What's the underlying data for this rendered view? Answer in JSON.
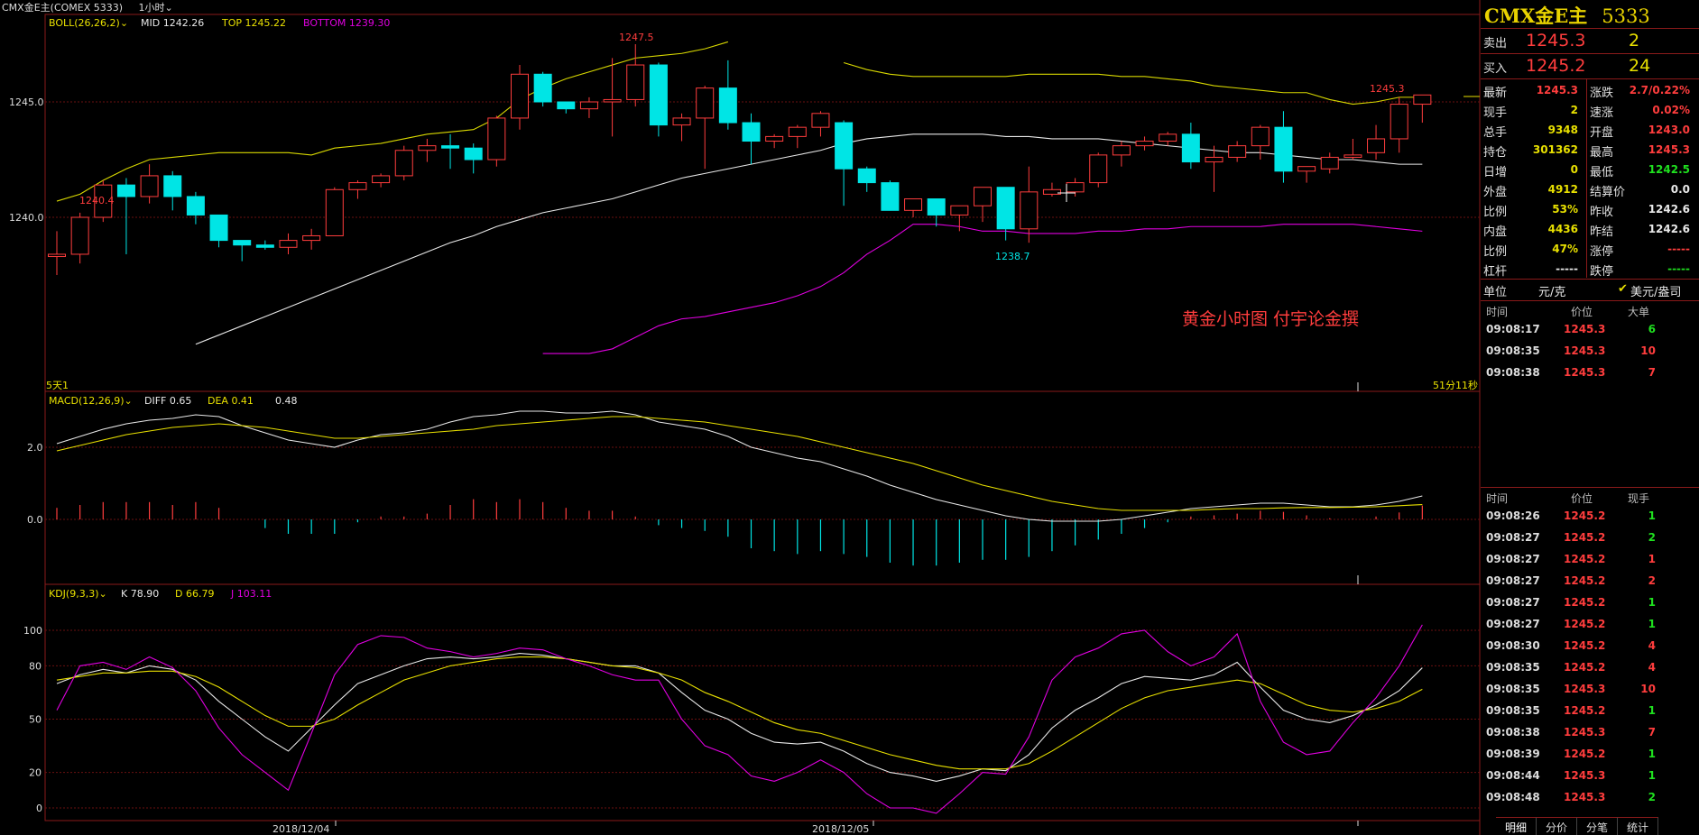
{
  "header": {
    "title": "CMX金E主(COMEX 5333)",
    "period": "1小时"
  },
  "indicators": {
    "boll": {
      "name": "BOLL(26,26,2)",
      "mid": "MID 1242.26",
      "top": "TOP 1245.22",
      "bottom": "BOTTOM 1239.30"
    },
    "macd": {
      "name": "MACD(12,26,9)",
      "diff": "DIFF 0.65",
      "dea": "DEA 0.41",
      "macd": "0.48"
    },
    "kdj": {
      "name": "KDJ(9,3,3)",
      "k": "K 78.90",
      "d": "D 66.79",
      "j": "J 103.11"
    }
  },
  "main_axis": {
    "labels": [
      "1245.0",
      "1240.0"
    ]
  },
  "macd_axis": {
    "labels": [
      "2.0",
      "0.0"
    ]
  },
  "kdj_axis": {
    "labels": [
      "100",
      "80",
      "50",
      "20",
      "0"
    ]
  },
  "x_axis": {
    "labels": [
      "2018/12/04",
      "2018/12/05"
    ]
  },
  "annotations": {
    "high": "1247.5",
    "left_high": "1240.4",
    "low": "1238.7",
    "last_high": "1245.3",
    "watermark": "黄金小时图  付宇论金撰",
    "left_tag": "5天1",
    "right_tag": "51分11秒"
  },
  "colors": {
    "up": "#ff3d3d",
    "down": "#00e5e5",
    "mid": "#e8e8e8",
    "upper": "#d8d800",
    "lower": "#e000e0",
    "grid": "#6a1010"
  },
  "chart_data": {
    "type": "candlestick",
    "candles": [
      [
        1238.3,
        1238.4,
        1237.5,
        1239.4
      ],
      [
        1238.4,
        1240.0,
        1238.0,
        1240.2
      ],
      [
        1240.0,
        1241.4,
        1239.8,
        1241.6
      ],
      [
        1241.4,
        1240.9,
        1238.4,
        1241.7
      ],
      [
        1240.9,
        1241.8,
        1240.6,
        1242.3
      ],
      [
        1241.8,
        1240.9,
        1240.3,
        1242.0
      ],
      [
        1240.9,
        1240.1,
        1239.7,
        1241.1
      ],
      [
        1240.1,
        1239.0,
        1238.7,
        1240.1
      ],
      [
        1239.0,
        1238.8,
        1238.1,
        1239.0
      ],
      [
        1238.8,
        1238.7,
        1238.6,
        1239.0
      ],
      [
        1238.7,
        1239.0,
        1238.4,
        1239.3
      ],
      [
        1239.0,
        1239.2,
        1238.6,
        1239.5
      ],
      [
        1239.2,
        1241.2,
        1239.2,
        1241.3
      ],
      [
        1241.2,
        1241.5,
        1240.8,
        1241.6
      ],
      [
        1241.5,
        1241.8,
        1241.3,
        1241.9
      ],
      [
        1241.8,
        1242.9,
        1241.6,
        1243.1
      ],
      [
        1242.9,
        1243.1,
        1242.4,
        1243.4
      ],
      [
        1243.1,
        1243.0,
        1242.1,
        1243.6
      ],
      [
        1243.0,
        1242.5,
        1241.9,
        1243.2
      ],
      [
        1242.5,
        1244.3,
        1242.2,
        1244.4
      ],
      [
        1244.3,
        1246.2,
        1243.8,
        1246.6
      ],
      [
        1246.2,
        1245.0,
        1244.8,
        1246.3
      ],
      [
        1245.0,
        1244.7,
        1244.5,
        1245.0
      ],
      [
        1244.7,
        1245.0,
        1244.3,
        1245.2
      ],
      [
        1245.0,
        1245.1,
        1243.5,
        1246.9
      ],
      [
        1245.1,
        1246.6,
        1244.8,
        1247.5
      ],
      [
        1246.6,
        1244.0,
        1243.5,
        1246.7
      ],
      [
        1244.0,
        1244.3,
        1243.3,
        1244.5
      ],
      [
        1244.3,
        1245.6,
        1242.1,
        1245.7
      ],
      [
        1245.6,
        1244.1,
        1243.8,
        1246.8
      ],
      [
        1244.1,
        1243.3,
        1242.3,
        1244.5
      ],
      [
        1243.3,
        1243.5,
        1243.0,
        1243.6
      ],
      [
        1243.5,
        1243.9,
        1243.0,
        1244.0
      ],
      [
        1243.9,
        1244.5,
        1243.5,
        1244.6
      ],
      [
        1244.1,
        1242.1,
        1240.5,
        1244.2
      ],
      [
        1242.1,
        1241.5,
        1241.1,
        1242.2
      ],
      [
        1241.5,
        1240.3,
        1240.3,
        1241.6
      ],
      [
        1240.3,
        1240.8,
        1240.0,
        1240.8
      ],
      [
        1240.8,
        1240.1,
        1239.6,
        1240.8
      ],
      [
        1240.1,
        1240.5,
        1239.4,
        1240.5
      ],
      [
        1240.5,
        1241.3,
        1239.8,
        1241.3
      ],
      [
        1241.3,
        1239.5,
        1239.0,
        1241.3
      ],
      [
        1239.5,
        1241.1,
        1238.9,
        1242.2
      ],
      [
        1241.0,
        1241.2,
        1240.9,
        1241.5
      ],
      [
        1241.1,
        1241.5,
        1240.9,
        1241.7
      ],
      [
        1241.5,
        1242.7,
        1241.3,
        1242.8
      ],
      [
        1242.7,
        1243.1,
        1242.2,
        1243.3
      ],
      [
        1243.1,
        1243.3,
        1242.9,
        1243.5
      ],
      [
        1243.3,
        1243.6,
        1243.1,
        1243.7
      ],
      [
        1243.6,
        1242.4,
        1242.1,
        1244.1
      ],
      [
        1242.4,
        1242.6,
        1241.1,
        1243.1
      ],
      [
        1242.6,
        1243.1,
        1242.4,
        1243.3
      ],
      [
        1243.1,
        1243.9,
        1242.5,
        1244.0
      ],
      [
        1243.9,
        1242.0,
        1241.5,
        1244.6
      ],
      [
        1242.0,
        1242.2,
        1241.5,
        1242.2
      ],
      [
        1242.1,
        1242.6,
        1241.9,
        1242.8
      ],
      [
        1242.6,
        1242.7,
        1242.5,
        1243.4
      ],
      [
        1242.8,
        1243.4,
        1242.5,
        1244.0
      ],
      [
        1243.4,
        1244.9,
        1242.8,
        1245.2
      ],
      [
        1244.9,
        1245.3,
        1244.1,
        1245.3
      ]
    ],
    "boll_upper": [
      1240.7,
      1241.0,
      1241.6,
      1242.1,
      1242.5,
      1242.6,
      1242.7,
      1242.8,
      1242.8,
      1242.8,
      1242.8,
      1242.7,
      1243.0,
      1243.1,
      1243.2,
      1243.4,
      1243.6,
      1243.7,
      1243.8,
      1244.3,
      1245.1,
      1245.6,
      1246.0,
      1246.3,
      1246.6,
      1246.9,
      1247.0,
      1247.1,
      1247.3,
      1247.6
    ],
    "boll_upper2": [
      null,
      null,
      null,
      null,
      null,
      null,
      null,
      null,
      null,
      null,
      null,
      null,
      null,
      null,
      null,
      null,
      null,
      null,
      null,
      null,
      null,
      null,
      null,
      null,
      null,
      null,
      null,
      null,
      null,
      null,
      null,
      null,
      null,
      null,
      1246.7,
      1246.4,
      1246.2,
      1246.1,
      1246.1,
      1246.1,
      1246.1,
      1246.1,
      1246.2,
      1246.2,
      1246.2,
      1246.2,
      1246.1,
      1246.1,
      1246.0,
      1245.9,
      1245.7,
      1245.6,
      1245.5,
      1245.4,
      1245.4,
      1245.1,
      1244.9,
      1245.0,
      1245.2,
      1245.2
    ],
    "boll_mid": [
      null,
      null,
      null,
      null,
      null,
      null,
      1234.5,
      1234.9,
      1235.3,
      1235.7,
      1236.1,
      1236.5,
      1236.9,
      1237.3,
      1237.7,
      1238.1,
      1238.5,
      1238.9,
      1239.2,
      1239.6,
      1239.9,
      1240.2,
      1240.4,
      1240.6,
      1240.8,
      1241.1,
      1241.4,
      1241.7,
      1241.9,
      1242.1,
      1242.3,
      1242.5,
      1242.7,
      1242.9,
      1243.2,
      1243.4,
      1243.5,
      1243.6,
      1243.6,
      1243.6,
      1243.6,
      1243.5,
      1243.5,
      1243.4,
      1243.4,
      1243.4,
      1243.3,
      1243.2,
      1243.1,
      1243.0,
      1242.9,
      1242.8,
      1242.8,
      1242.7,
      1242.6,
      1242.5,
      1242.5,
      1242.4,
      1242.3,
      1242.3
    ],
    "boll_lower": [
      null,
      null,
      null,
      null,
      null,
      null,
      null,
      null,
      null,
      null,
      null,
      null,
      null,
      null,
      null,
      null,
      null,
      null,
      null,
      null,
      null,
      1234.1,
      1234.1,
      1234.1,
      1234.3,
      1234.8,
      1235.3,
      1235.6,
      1235.7,
      1235.9,
      1236.1,
      1236.3,
      1236.6,
      1237.0,
      1237.6,
      1238.4,
      1239.0,
      1239.7,
      1239.7,
      1239.6,
      1239.4,
      1239.4,
      1239.3,
      1239.3,
      1239.3,
      1239.4,
      1239.4,
      1239.5,
      1239.5,
      1239.6,
      1239.6,
      1239.6,
      1239.6,
      1239.7,
      1239.7,
      1239.7,
      1239.7,
      1239.6,
      1239.5,
      1239.4
    ],
    "macd_diff": [
      2.1,
      2.3,
      2.5,
      2.65,
      2.75,
      2.8,
      2.9,
      2.85,
      2.6,
      2.4,
      2.2,
      2.1,
      2.0,
      2.2,
      2.35,
      2.4,
      2.5,
      2.7,
      2.85,
      2.9,
      3.0,
      3.0,
      2.95,
      2.95,
      3.0,
      2.9,
      2.7,
      2.6,
      2.5,
      2.3,
      2.0,
      1.85,
      1.7,
      1.6,
      1.4,
      1.2,
      0.95,
      0.75,
      0.55,
      0.4,
      0.25,
      0.1,
      0.0,
      -0.05,
      -0.05,
      -0.05,
      0.0,
      0.1,
      0.2,
      0.3,
      0.35,
      0.4,
      0.45,
      0.45,
      0.4,
      0.35,
      0.35,
      0.4,
      0.5,
      0.65
    ],
    "macd_dea": [
      1.9,
      2.05,
      2.2,
      2.35,
      2.45,
      2.55,
      2.6,
      2.65,
      2.6,
      2.55,
      2.45,
      2.35,
      2.25,
      2.25,
      2.3,
      2.35,
      2.4,
      2.45,
      2.5,
      2.6,
      2.65,
      2.7,
      2.75,
      2.8,
      2.85,
      2.85,
      2.8,
      2.75,
      2.7,
      2.6,
      2.5,
      2.4,
      2.3,
      2.15,
      2.0,
      1.85,
      1.7,
      1.55,
      1.35,
      1.15,
      0.95,
      0.8,
      0.65,
      0.5,
      0.4,
      0.3,
      0.25,
      0.25,
      0.25,
      0.25,
      0.28,
      0.3,
      0.3,
      0.32,
      0.33,
      0.33,
      0.34,
      0.35,
      0.38,
      0.41
    ],
    "kdj_k": [
      70,
      75,
      78,
      76,
      80,
      78,
      72,
      60,
      50,
      40,
      32,
      45,
      58,
      70,
      75,
      80,
      84,
      85,
      84,
      85,
      87,
      86,
      84,
      82,
      80,
      80,
      76,
      65,
      55,
      50,
      42,
      37,
      36,
      37,
      32,
      25,
      20,
      18,
      15,
      18,
      22,
      21,
      30,
      45,
      55,
      62,
      70,
      74,
      73,
      72,
      75,
      82,
      68,
      55,
      50,
      48,
      52,
      58,
      66,
      78.9
    ],
    "kdj_d": [
      72,
      74,
      76,
      76,
      77,
      77,
      74,
      68,
      60,
      52,
      46,
      46,
      50,
      58,
      65,
      72,
      76,
      80,
      82,
      84,
      85,
      85,
      84,
      82,
      80,
      79,
      76,
      72,
      65,
      60,
      54,
      48,
      44,
      42,
      38,
      34,
      30,
      27,
      24,
      22,
      22,
      22,
      25,
      32,
      40,
      48,
      56,
      62,
      66,
      68,
      70,
      72,
      70,
      64,
      58,
      55,
      54,
      56,
      60,
      66.79
    ],
    "kdj_j": [
      55,
      80,
      82,
      78,
      85,
      79,
      66,
      45,
      30,
      20,
      10,
      42,
      75,
      92,
      97,
      96,
      90,
      88,
      85,
      87,
      90,
      89,
      84,
      80,
      75,
      72,
      72,
      50,
      35,
      30,
      18,
      15,
      20,
      27,
      20,
      8,
      0,
      0,
      -3,
      8,
      20,
      19,
      40,
      72,
      85,
      90,
      98,
      100,
      88,
      80,
      85,
      98,
      60,
      37,
      30,
      32,
      48,
      62,
      80,
      103.11
    ]
  },
  "right_panel": {
    "title": "CMX金E主",
    "code": "5333",
    "sell": {
      "label": "卖出",
      "price": "1245.3",
      "qty": "2"
    },
    "buy": {
      "label": "买入",
      "price": "1245.2",
      "qty": "24"
    },
    "stats_left": [
      {
        "label": "最新",
        "value": "1245.3",
        "color": "red"
      },
      {
        "label": "现手",
        "value": "2",
        "color": "yellow"
      },
      {
        "label": "总手",
        "value": "9348",
        "color": "yellow"
      },
      {
        "label": "持仓",
        "value": "301362",
        "color": "yellow"
      },
      {
        "label": "日增",
        "value": "0",
        "color": "yellow"
      },
      {
        "label": "外盘",
        "value": "4912",
        "color": "yellow"
      },
      {
        "label": "比例",
        "value": "53%",
        "color": "yellow"
      },
      {
        "label": "内盘",
        "value": "4436",
        "color": "yellow"
      },
      {
        "label": "比例",
        "value": "47%",
        "color": "yellow"
      },
      {
        "label": "杠杆",
        "value": "-----",
        "color": "white"
      }
    ],
    "stats_right": [
      {
        "label": "涨跌",
        "value": "2.7/0.22%",
        "color": "red"
      },
      {
        "label": "速涨",
        "value": "0.02%",
        "color": "red"
      },
      {
        "label": "开盘",
        "value": "1243.0",
        "color": "red"
      },
      {
        "label": "最高",
        "value": "1245.3",
        "color": "red"
      },
      {
        "label": "最低",
        "value": "1242.5",
        "color": "green"
      },
      {
        "label": "结算价",
        "value": "0.0",
        "color": "white"
      },
      {
        "label": "昨收",
        "value": "1242.6",
        "color": "white"
      },
      {
        "label": "昨结",
        "value": "1242.6",
        "color": "white"
      },
      {
        "label": "涨停",
        "value": "-----",
        "color": "red"
      },
      {
        "label": "跌停",
        "value": "-----",
        "color": "green"
      }
    ],
    "unit": {
      "label": "单位",
      "value": "元/克",
      "alt": "美元/盎司"
    },
    "big_orders": {
      "headers": [
        "时间",
        "价位",
        "大单"
      ],
      "rows": [
        {
          "time": "09:08:17",
          "price": "1245.3",
          "qty": "6",
          "qcolor": "green"
        },
        {
          "time": "09:08:35",
          "price": "1245.3",
          "qty": "10",
          "qcolor": "red"
        },
        {
          "time": "09:08:38",
          "price": "1245.3",
          "qty": "7",
          "qcolor": "red"
        }
      ]
    },
    "ticks": {
      "headers": [
        "时间",
        "价位",
        "现手"
      ],
      "rows": [
        {
          "time": "09:08:26",
          "price": "1245.2",
          "qty": "1",
          "qcolor": "green"
        },
        {
          "time": "09:08:27",
          "price": "1245.2",
          "qty": "2",
          "qcolor": "green"
        },
        {
          "time": "09:08:27",
          "price": "1245.2",
          "qty": "1",
          "qcolor": "red"
        },
        {
          "time": "09:08:27",
          "price": "1245.2",
          "qty": "2",
          "qcolor": "red"
        },
        {
          "time": "09:08:27",
          "price": "1245.2",
          "qty": "1",
          "qcolor": "green"
        },
        {
          "time": "09:08:27",
          "price": "1245.2",
          "qty": "1",
          "qcolor": "green"
        },
        {
          "time": "09:08:30",
          "price": "1245.2",
          "qty": "4",
          "qcolor": "red"
        },
        {
          "time": "09:08:35",
          "price": "1245.2",
          "qty": "4",
          "qcolor": "red"
        },
        {
          "time": "09:08:35",
          "price": "1245.3",
          "qty": "10",
          "qcolor": "red"
        },
        {
          "time": "09:08:35",
          "price": "1245.2",
          "qty": "1",
          "qcolor": "green"
        },
        {
          "time": "09:08:38",
          "price": "1245.3",
          "qty": "7",
          "qcolor": "red"
        },
        {
          "time": "09:08:39",
          "price": "1245.2",
          "qty": "1",
          "qcolor": "green"
        },
        {
          "time": "09:08:44",
          "price": "1245.3",
          "qty": "1",
          "qcolor": "green"
        },
        {
          "time": "09:08:48",
          "price": "1245.3",
          "qty": "2",
          "qcolor": "green"
        }
      ]
    },
    "tabs": [
      "明细",
      "分价",
      "分笔",
      "统计"
    ]
  }
}
